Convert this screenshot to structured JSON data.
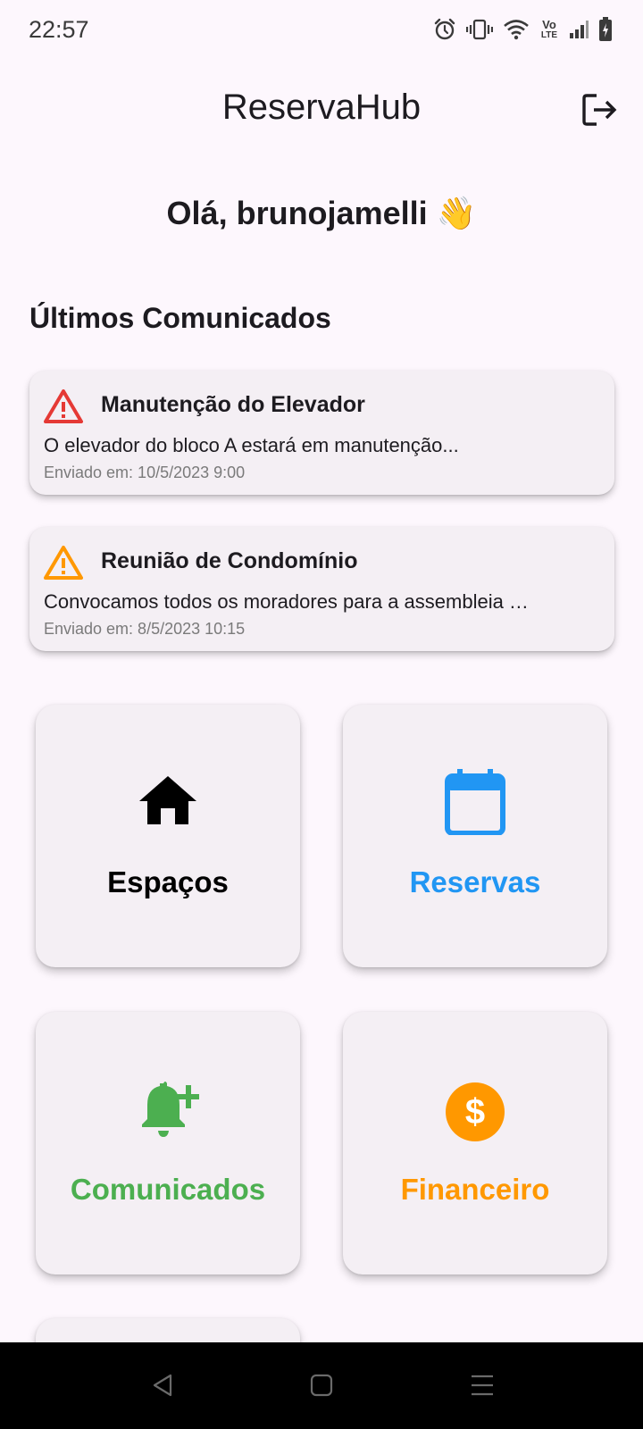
{
  "status_bar": {
    "time": "22:57",
    "icons": [
      "alarm-icon",
      "vibrate-icon",
      "wifi-icon",
      "volte-icon",
      "signal-icon",
      "battery-charging-icon"
    ],
    "volte_top": "Vo",
    "volte_bottom": "LTE"
  },
  "app_bar": {
    "title": "ReservaHub",
    "logout_icon": "logout-icon"
  },
  "greeting": "Olá, brunojamelli 👋",
  "notices_section": {
    "title": "Últimos Comunicados",
    "items": [
      {
        "title": "Manutenção do Elevador",
        "body": "O elevador do bloco A estará em manutenção...",
        "date": "Enviado em: 10/5/2023 9:00",
        "icon": "warning-icon",
        "color": "#e53935"
      },
      {
        "title": "Reunião de Condomínio",
        "body": "Convocamos todos os moradores para a assembleia …",
        "date": "Enviado em: 8/5/2023 10:15",
        "icon": "warning-icon",
        "color": "#ff9800"
      }
    ]
  },
  "tiles": [
    {
      "label": "Espaços",
      "icon": "home-icon",
      "color": "#000000"
    },
    {
      "label": "Reservas",
      "icon": "calendar-icon",
      "color": "#2196f3"
    },
    {
      "label": "Comunicados",
      "icon": "add-alert-icon",
      "color": "#4caf50"
    },
    {
      "label": "Financeiro",
      "icon": "dollar-icon",
      "color": "#ff9800"
    }
  ],
  "nav_bar": {
    "icons": [
      "back-icon",
      "home-square-icon",
      "recents-icon"
    ]
  }
}
